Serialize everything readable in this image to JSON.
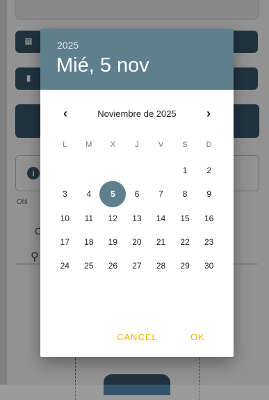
{
  "background": {
    "obligatory_hint": "Obl",
    "partial_label": "C"
  },
  "picker": {
    "year": "2025",
    "selected_date_title": "Mié, 5 nov",
    "month_label": "Noviembre de 2025",
    "weekdays": [
      "L",
      "M",
      "X",
      "J",
      "V",
      "S",
      "D"
    ],
    "selected_day": "5",
    "leading_blanks": 5,
    "days": [
      "1",
      "2",
      "3",
      "4",
      "5",
      "6",
      "7",
      "8",
      "9",
      "10",
      "11",
      "12",
      "13",
      "14",
      "15",
      "16",
      "17",
      "18",
      "19",
      "20",
      "21",
      "22",
      "23",
      "24",
      "25",
      "26",
      "27",
      "28",
      "29",
      "30"
    ],
    "cancel_label": "CANCEL",
    "ok_label": "OK"
  },
  "colors": {
    "header": "#5f7f8e",
    "accent_action": "#f5b000",
    "app_primary": "#35566a"
  }
}
